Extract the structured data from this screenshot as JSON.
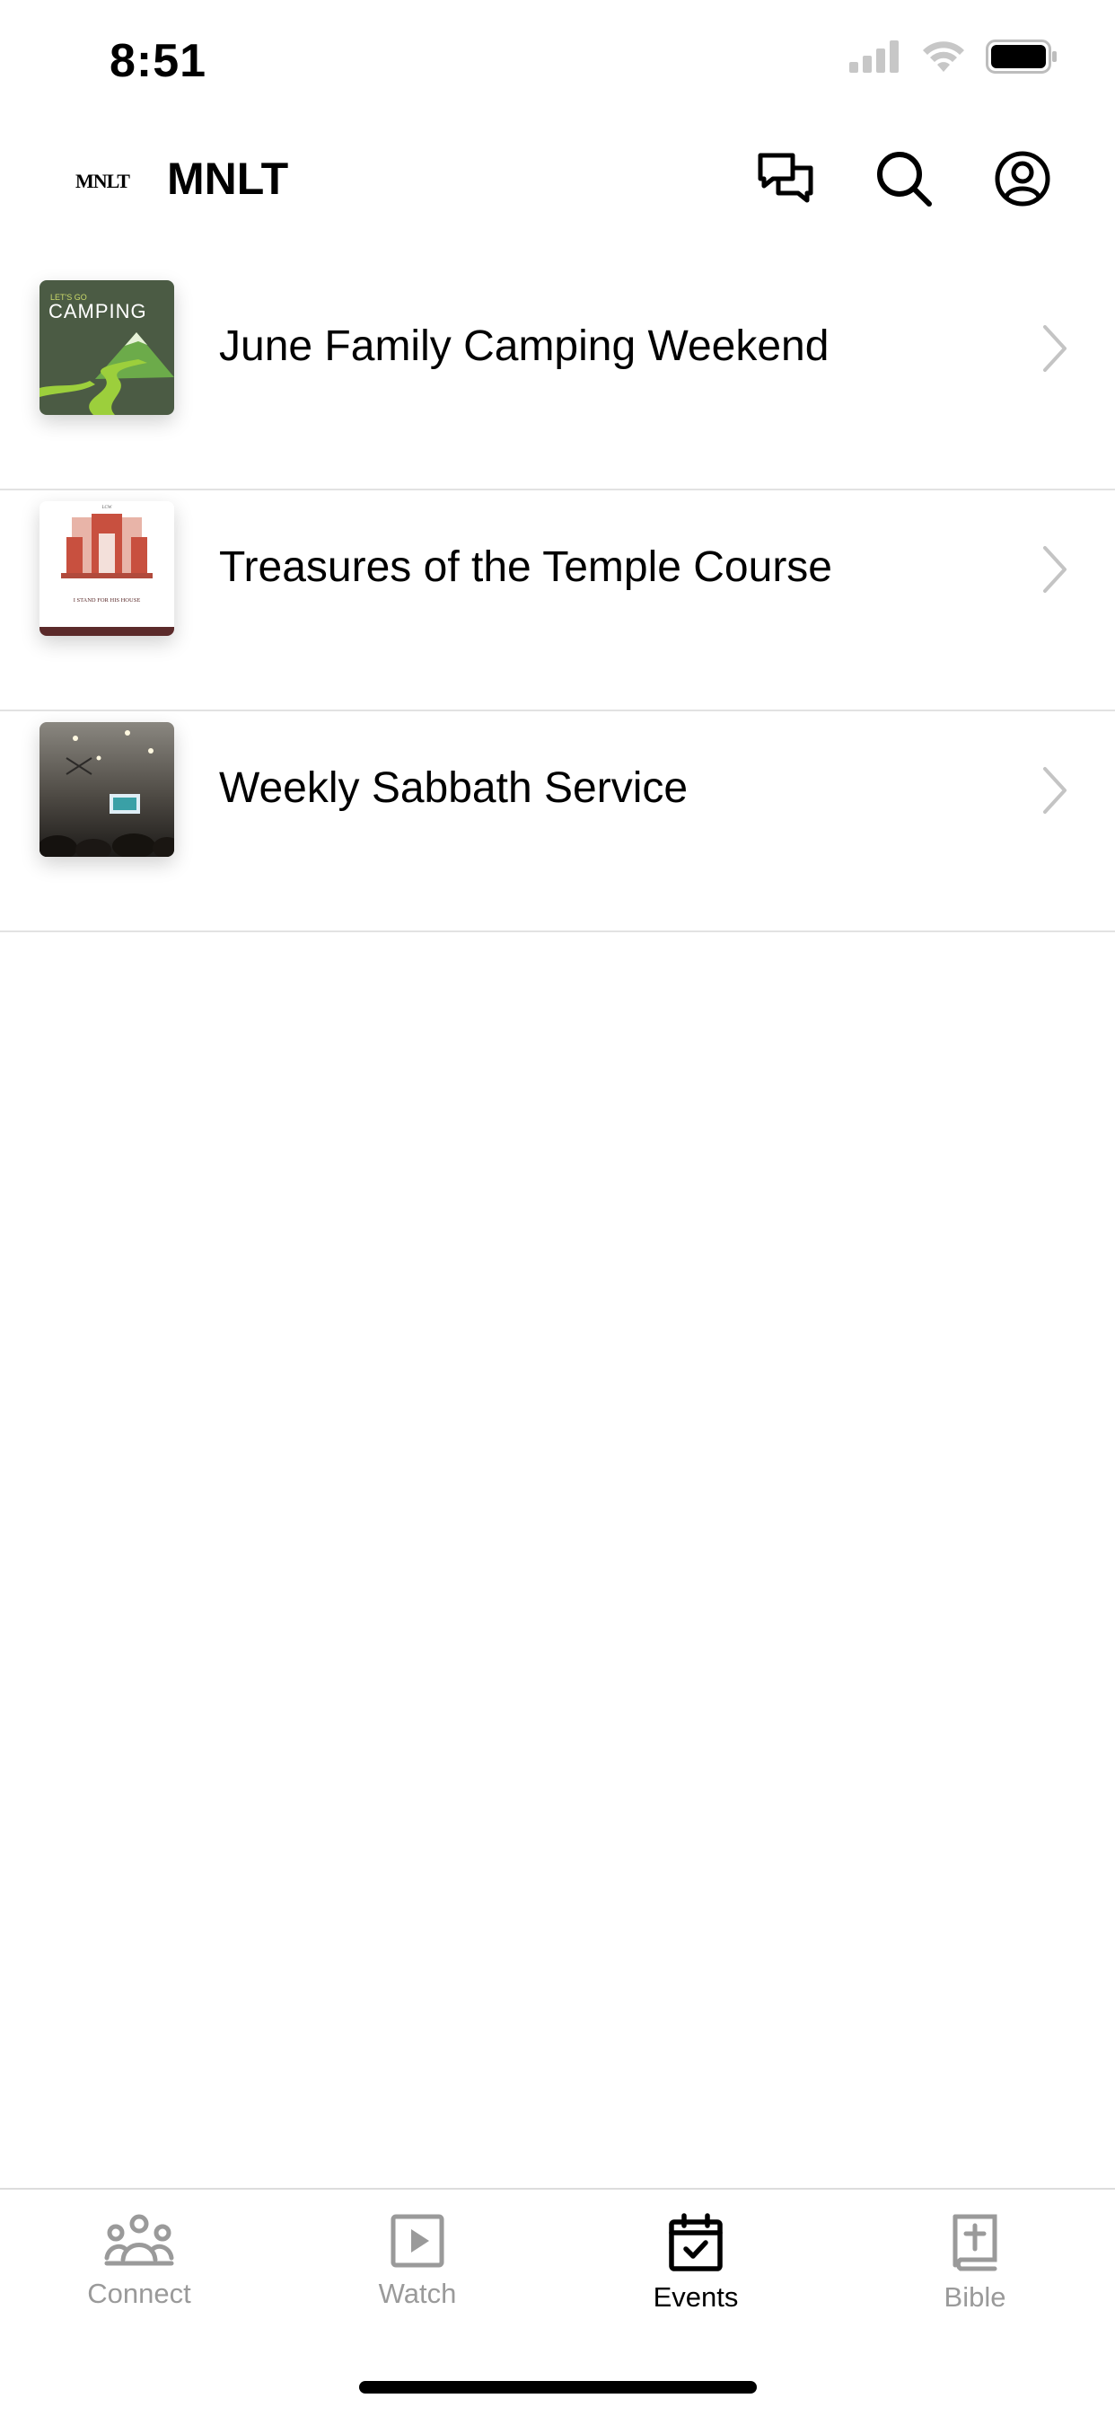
{
  "status_bar": {
    "time": "8:51"
  },
  "header": {
    "logo_text": "MNLT",
    "title": "MNLT"
  },
  "icons": {
    "chat": "chat-bubbles-icon",
    "search": "search-icon",
    "profile": "profile-icon",
    "chevron": "chevron-right-icon"
  },
  "events": [
    {
      "title": "June Family Camping Weekend",
      "thumb_text": "CAMPING",
      "thumb_subtext": "LET'S GO"
    },
    {
      "title": "Treasures of the Temple Course",
      "thumb_text": "I STAND FOR HIS HOUSE",
      "thumb_subtext": "LCW"
    },
    {
      "title": "Weekly Sabbath Service"
    }
  ],
  "tabs": [
    {
      "label": "Connect",
      "icon": "people-icon",
      "active": false
    },
    {
      "label": "Watch",
      "icon": "play-icon",
      "active": false
    },
    {
      "label": "Events",
      "icon": "calendar-check-icon",
      "active": true
    },
    {
      "label": "Bible",
      "icon": "bible-icon",
      "active": false
    }
  ],
  "colors": {
    "active": "#000000",
    "inactive": "#9a9a9a",
    "divider": "#e2e2e2"
  }
}
